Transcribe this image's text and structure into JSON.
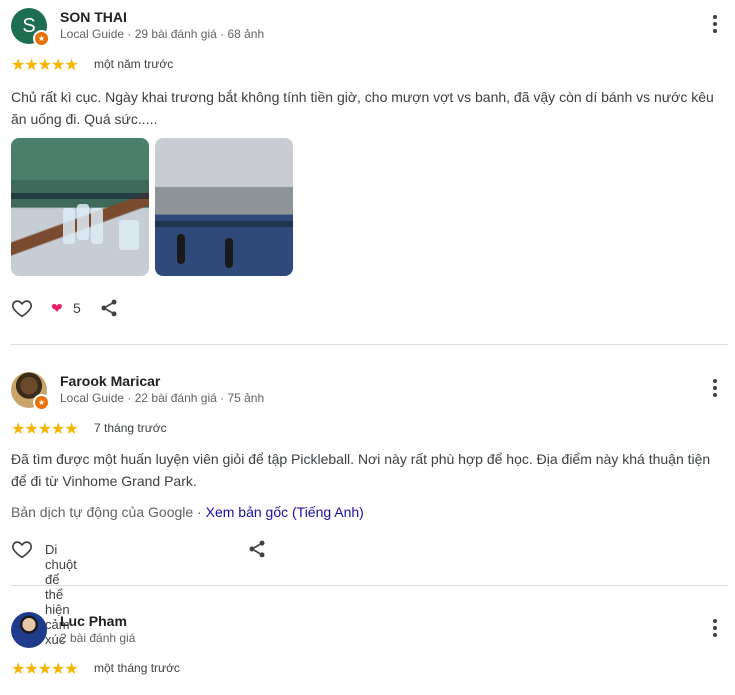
{
  "reviews": [
    {
      "avatar_letter": "S",
      "name": "SON THAI",
      "meta": "Local Guide · 29 bài đánh giá · 68 ảnh",
      "stars": "★★★★★",
      "date": "một năm trước",
      "text": "Chủ rất kì cục. Ngày khai trương bắt không tính tiền giờ, cho mượn vợt vs banh, đã vậy còn dí bánh vs nước kêu ăn uống đi. Quá sức.....",
      "reaction_count": "5",
      "reaction_emoji": "❤"
    },
    {
      "name": "Farook Maricar",
      "meta": "Local Guide · 22 bài đánh giá · 75 ảnh",
      "stars": "★★★★★",
      "date": "7 tháng trước",
      "text": "Đã tìm được một huấn luyện viên giỏi để tập Pickleball. Nơi này rất phù hợp để học. Địa điểm này khá thuận tiện để đi từ Vinhome Grand Park.",
      "translation_prefix": "Bản dịch tự động của Google · ",
      "translation_link": "Xem bản gốc (Tiếng Anh)",
      "hover_hint": "Di chuột để thể hiện cảm xúc"
    },
    {
      "name": "Luc Pham",
      "meta": "2 bài đánh giá",
      "stars": "★★★★★",
      "date": "một tháng trước"
    }
  ],
  "colors": {
    "star": "#f4b400",
    "link": "#1a0dab",
    "heart": "#e91e63",
    "avatar_s": "#1e6f52"
  }
}
